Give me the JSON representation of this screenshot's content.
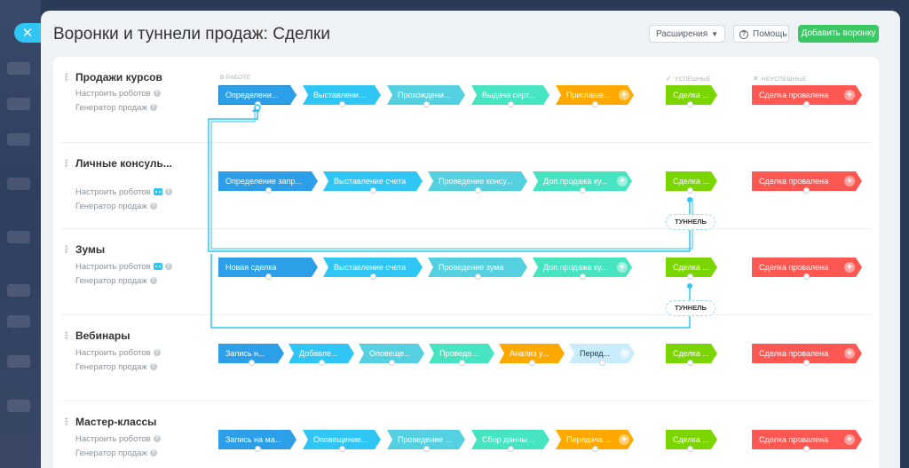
{
  "header": {
    "title": "Воронки и туннели продаж: Сделки",
    "extensions_label": "Расширения",
    "help_label": "Помощь",
    "add_label": "Добавить воронку"
  },
  "columns": {
    "in_progress": "В РАБОТЕ",
    "success": "УСПЕШНЫЕ",
    "failed": "НЕУСПЕШНЫЕ"
  },
  "common": {
    "robots": "Настроить роботов",
    "generator": "Генератор продаж",
    "tunnel": "ТУННЕЛЬ"
  },
  "colors": {
    "blue": "#2d9ee8",
    "cyan": "#2fc6f6",
    "teal": "#55d0e0",
    "green": "#47e4c2",
    "orange": "#ffa900",
    "light": "#c8ecfb",
    "success": "#7bd500",
    "fail": "#ff5752",
    "tunnel_line": "#2fc6f6"
  },
  "funnels": [
    {
      "name": "Продажи курсов",
      "robot_icon": false,
      "stages": [
        {
          "label": "Определени...",
          "color": "blue"
        },
        {
          "label": "Выставление...",
          "color": "cyan"
        },
        {
          "label": "Прохождени...",
          "color": "teal"
        },
        {
          "label": "Выдача серт...",
          "color": "green"
        },
        {
          "label": "Приглаше...",
          "color": "orange"
        }
      ],
      "success": "Сделка ...",
      "fail": "Сделка провалена"
    },
    {
      "name": "Личные консуль...",
      "robot_icon": true,
      "stages": [
        {
          "label": "Определение запр...",
          "color": "blue"
        },
        {
          "label": "Выставление счета",
          "color": "cyan"
        },
        {
          "label": "Проведение консу...",
          "color": "teal"
        },
        {
          "label": "Доп.продажа ку...",
          "color": "green"
        }
      ],
      "success": "Сделка ...",
      "fail": "Сделка провалена"
    },
    {
      "name": "Зумы",
      "robot_icon": true,
      "stages": [
        {
          "label": "Новая сделка",
          "color": "blue"
        },
        {
          "label": "Выставление счета",
          "color": "cyan"
        },
        {
          "label": "Проведение зума",
          "color": "teal"
        },
        {
          "label": "Доп.продажа ку...",
          "color": "green"
        }
      ],
      "success": "Сделка ...",
      "fail": "Сделка провалена"
    },
    {
      "name": "Вебинары",
      "robot_icon": false,
      "stages": [
        {
          "label": "Запись н...",
          "color": "blue"
        },
        {
          "label": "Добавле...",
          "color": "cyan"
        },
        {
          "label": "Оповеще...",
          "color": "teal"
        },
        {
          "label": "Проведе...",
          "color": "green"
        },
        {
          "label": "Анализ у...",
          "color": "orange"
        },
        {
          "label": "Перед...",
          "color": "light"
        }
      ],
      "success": "Сделка ...",
      "fail": "Сделка провалена"
    },
    {
      "name": "Мастер-классы",
      "robot_icon": false,
      "stages": [
        {
          "label": "Запись на ма...",
          "color": "blue"
        },
        {
          "label": "Оповещение...",
          "color": "cyan"
        },
        {
          "label": "Проведение ...",
          "color": "teal"
        },
        {
          "label": "Сбор данных...",
          "color": "green"
        },
        {
          "label": "Передача ...",
          "color": "orange"
        }
      ],
      "success": "Сделка ...",
      "fail": "Сделка провалена"
    }
  ]
}
